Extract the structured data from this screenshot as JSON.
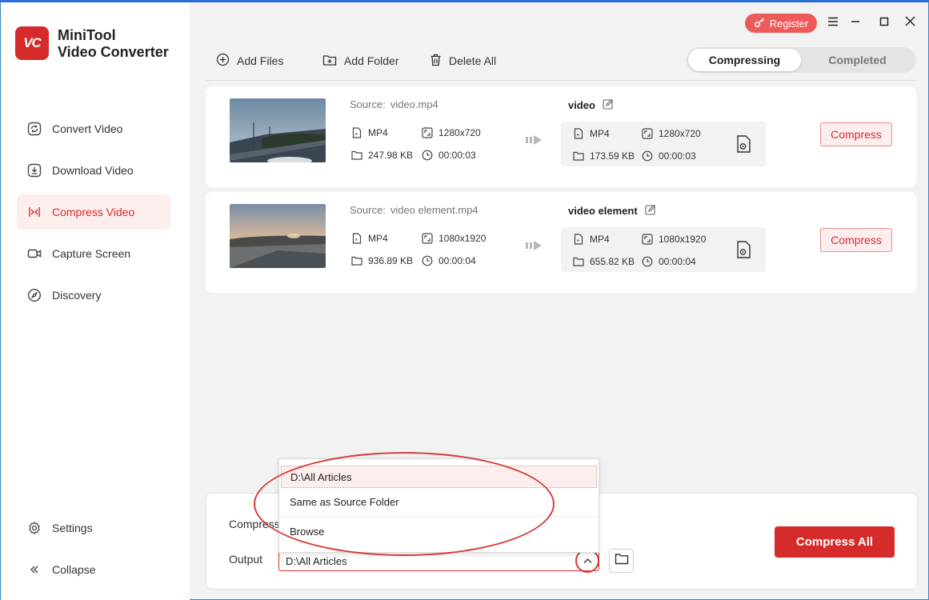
{
  "app": {
    "brand_line1": "MiniTool",
    "brand_line2": "Video Converter",
    "logo_text": "VC",
    "accent": "#d62b2b"
  },
  "sidebar": {
    "items": [
      {
        "label": "Convert Video",
        "icon": "convert-icon"
      },
      {
        "label": "Download Video",
        "icon": "download-icon"
      },
      {
        "label": "Compress Video",
        "icon": "compress-icon",
        "active": true
      },
      {
        "label": "Capture Screen",
        "icon": "camera-icon"
      },
      {
        "label": "Discovery",
        "icon": "compass-icon"
      }
    ],
    "settings_label": "Settings",
    "collapse_label": "Collapse"
  },
  "header": {
    "register_label": "Register"
  },
  "toolbar": {
    "add_files": "Add Files",
    "add_folder": "Add Folder",
    "delete_all": "Delete All"
  },
  "tabs": {
    "compressing": "Compressing",
    "completed": "Completed"
  },
  "files": [
    {
      "source_label": "Source:",
      "source": "video.mp4",
      "format": "MP4",
      "resolution": "1280x720",
      "size": "247.98 KB",
      "duration": "00:00:03",
      "output_name": "video",
      "out_format": "MP4",
      "out_resolution": "1280x720",
      "out_size": "173.59 KB",
      "out_duration": "00:00:03",
      "button": "Compress"
    },
    {
      "source_label": "Source:",
      "source": "video element.mp4",
      "format": "MP4",
      "resolution": "1080x1920",
      "size": "936.89 KB",
      "duration": "00:00:04",
      "output_name": "video element",
      "out_format": "MP4",
      "out_resolution": "1080x1920",
      "out_size": "655.82 KB",
      "out_duration": "00:00:04",
      "button": "Compress"
    }
  ],
  "bottom": {
    "compress_label": "Compress",
    "output_label": "Output",
    "output_value": "D:\\All Articles",
    "compress_all": "Compress All"
  },
  "dropdown": {
    "options": [
      "D:\\All Articles",
      "Same as Source Folder",
      "Browse"
    ]
  }
}
